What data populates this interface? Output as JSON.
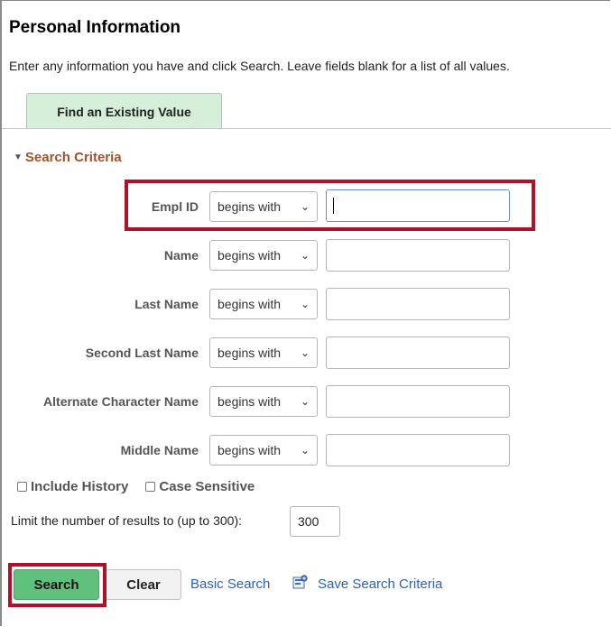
{
  "page": {
    "title": "Personal Information",
    "instructions": "Enter any information you have and click Search. Leave fields blank for a list of all values."
  },
  "tabs": [
    {
      "label": "Find an Existing Value"
    }
  ],
  "search_criteria": {
    "heading": "Search Criteria",
    "fields": [
      {
        "label": "Empl ID",
        "operator": "begins with",
        "value": ""
      },
      {
        "label": "Name",
        "operator": "begins with",
        "value": ""
      },
      {
        "label": "Last Name",
        "operator": "begins with",
        "value": ""
      },
      {
        "label": "Second Last Name",
        "operator": "begins with",
        "value": ""
      },
      {
        "label": "Alternate Character Name",
        "operator": "begins with",
        "value": ""
      },
      {
        "label": "Middle Name",
        "operator": "begins with",
        "value": ""
      }
    ],
    "include_history": {
      "label": "Include History",
      "checked": false
    },
    "case_sensitive": {
      "label": "Case Sensitive",
      "checked": false
    },
    "limit": {
      "label": "Limit the number of results to (up to 300):",
      "value": "300"
    }
  },
  "actions": {
    "search": "Search",
    "clear": "Clear",
    "basic_search": "Basic Search",
    "save_search": "Save Search Criteria"
  },
  "colors": {
    "highlight": "#b0102a",
    "search_button": "#5fc17b",
    "tab_background": "#d5efd9",
    "criteria_heading": "#a0522d",
    "link": "#2b62b8"
  },
  "icons": {
    "section_toggle": "triangle-down-icon",
    "select_arrow": "chevron-down-icon",
    "save_search": "save-search-icon"
  }
}
